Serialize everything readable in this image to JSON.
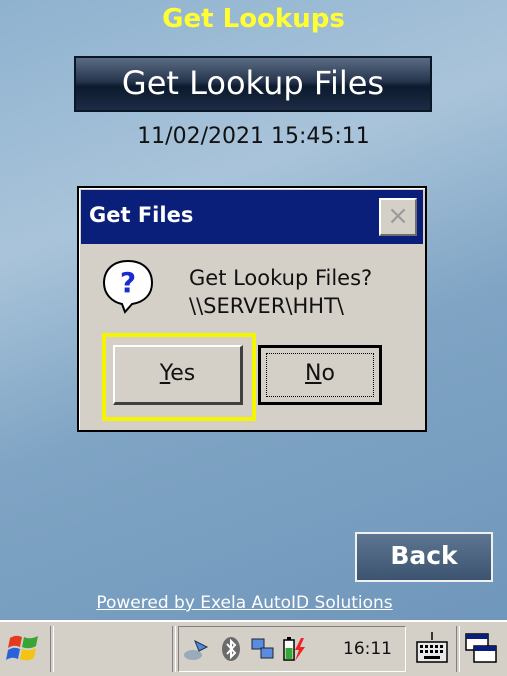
{
  "screen": {
    "title": "Get Lookups",
    "main_button_label": "Get Lookup Files",
    "datetime": "11/02/2021 15:45:11",
    "back_label": "Back",
    "powered_by": "Powered by Exela AutoID Solutions"
  },
  "dialog": {
    "title": "Get Files",
    "close_symbol": "×",
    "message_line1": "Get Lookup Files?",
    "message_line2": "\\\\SERVER\\HHT\\",
    "yes_prefix": "",
    "yes_mnemonic": "Y",
    "yes_rest": "es",
    "no_mnemonic": "N",
    "no_rest": "o",
    "icon": "question-icon"
  },
  "taskbar": {
    "clock": "16:11",
    "icons": [
      "windows-start-icon",
      "network-icon",
      "bluetooth-icon",
      "sync-icon",
      "battery-icon",
      "keyboard-icon",
      "window-switch-icon"
    ]
  },
  "colors": {
    "title": "#ffff33",
    "dialog_titlebar": "#0a1f7a",
    "highlight": "#f5f500"
  }
}
